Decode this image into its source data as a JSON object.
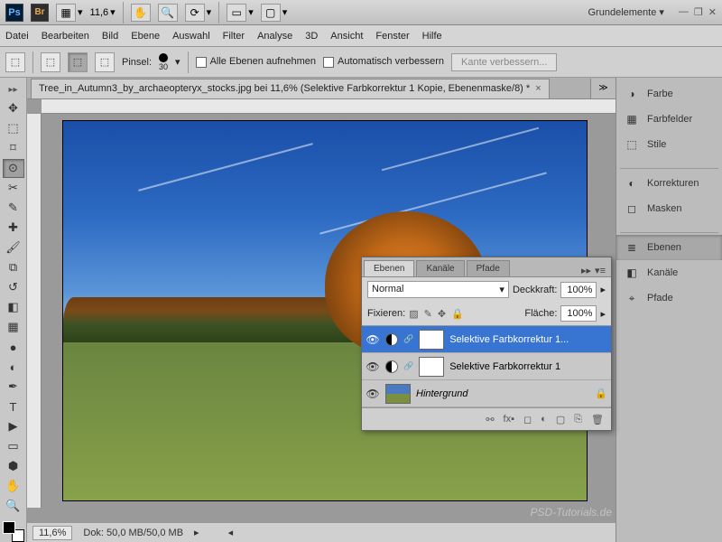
{
  "app": {
    "workspace_label": "Grundelemente ▾",
    "zoom_text": "11,6"
  },
  "menu": {
    "items": [
      "Datei",
      "Bearbeiten",
      "Bild",
      "Ebene",
      "Auswahl",
      "Filter",
      "Analyse",
      "3D",
      "Ansicht",
      "Fenster",
      "Hilfe"
    ]
  },
  "options": {
    "brush_label": "Pinsel:",
    "brush_size": "30",
    "cb1": "Alle Ebenen aufnehmen",
    "cb2": "Automatisch verbessern",
    "btn1": "Kante verbessern..."
  },
  "document": {
    "tab_title": "Tree_in_Autumn3_by_archaeopteryx_stocks.jpg bei 11,6% (Selektive Farbkorrektur 1 Kopie, Ebenenmaske/8) *"
  },
  "layers_panel": {
    "tabs": [
      "Ebenen",
      "Kanäle",
      "Pfade"
    ],
    "blend_mode": "Normal",
    "opacity_label": "Deckkraft:",
    "opacity_value": "100%",
    "lock_label": "Fixieren:",
    "fill_label": "Fläche:",
    "fill_value": "100%",
    "layers": [
      {
        "name": "Selektive Farbkorrektur 1...",
        "selected": true,
        "type": "adjustment"
      },
      {
        "name": "Selektive Farbkorrektur 1",
        "selected": false,
        "type": "adjustment"
      },
      {
        "name": "Hintergrund",
        "selected": false,
        "type": "background"
      }
    ]
  },
  "status": {
    "zoom": "11,6%",
    "doc_info": "Dok: 50,0 MB/50,0 MB"
  },
  "dock": {
    "group1": [
      "Farbe",
      "Farbfelder",
      "Stile"
    ],
    "group2": [
      "Korrekturen",
      "Masken"
    ],
    "group3": [
      "Ebenen",
      "Kanäle",
      "Pfade"
    ]
  },
  "watermark": "PSD-Tutorials.de"
}
